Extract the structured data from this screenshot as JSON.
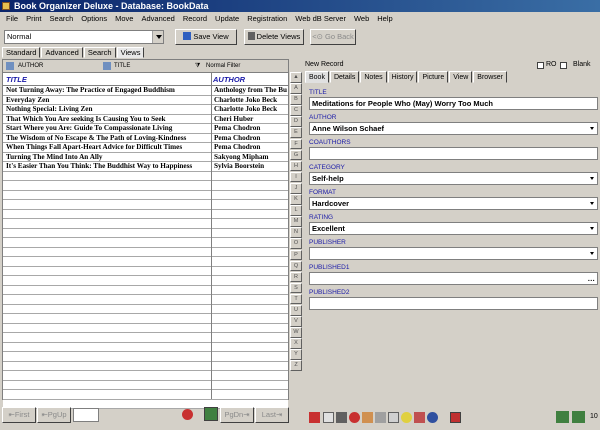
{
  "window": {
    "title": "Book Organizer Deluxe - Database: BookData"
  },
  "menu": [
    "File",
    "Print",
    "Search",
    "Options",
    "Move",
    "Advanced",
    "Record",
    "Update",
    "Registration",
    "Web dB Server",
    "Web",
    "Help"
  ],
  "toolbar": {
    "view_value": "Normal",
    "save_view": "Save View",
    "delete_views": "Delete Views",
    "go_back": "Go Back"
  },
  "left_tabs": [
    "Standard",
    "Advanced",
    "Search",
    "Views"
  ],
  "column_bar": {
    "author": "AUTHOR",
    "title": "TITLE",
    "filter": "Normal Filter"
  },
  "grid": {
    "headers": [
      "TITLE",
      "AUTHOR"
    ],
    "rows": [
      [
        "Not Turning Away: The Practice of Engaged Buddhism",
        "Anthology from The Bu"
      ],
      [
        "Everyday Zen",
        "Charlotte Joko Beck"
      ],
      [
        "Nothing Special: Living Zen",
        "Charlotte Joko Beck"
      ],
      [
        "That Which You Are seeking Is Causing You to Seek",
        "Cheri Huber"
      ],
      [
        "Start Where you Are: Guide To Compassionate Living",
        "Pema Chodron"
      ],
      [
        "The Wisdom of No Escape & The Path of Loving-Kindness",
        "Pema Chodron"
      ],
      [
        "When Things Fall Apart-Heart Advice for Difficult Times",
        "Pema Chodron"
      ],
      [
        "Turning The Mind Into An Ally",
        "Sakyong Mipham"
      ],
      [
        "It's Easier Than You Think: The Buddhist Way to Happiness",
        "Sylvia Boorstein"
      ]
    ]
  },
  "nav": {
    "first": "First",
    "pgup": "PgUp",
    "pgdn": "PgDn",
    "last": "Last"
  },
  "alphabet": [
    "A",
    "B",
    "C",
    "D",
    "E",
    "F",
    "G",
    "H",
    "I",
    "J",
    "K",
    "L",
    "M",
    "N",
    "O",
    "P",
    "Q",
    "R",
    "S",
    "T",
    "U",
    "V",
    "W",
    "X",
    "Y",
    "Z"
  ],
  "record": {
    "status": "New Record",
    "ro_label": "RO",
    "blank_label": "Blank"
  },
  "right_tabs": [
    "Book",
    "Details",
    "Notes",
    "History",
    "Picture",
    "View",
    "Browser"
  ],
  "fields": {
    "title_label": "TITLE",
    "title_value": "Meditations for People Who (May) Worry Too Much",
    "author_label": "AUTHOR",
    "author_value": "Anne Wilson Schaef",
    "coauthors_label": "COAUTHORS",
    "coauthors_value": "",
    "category_label": "CATEGORY",
    "category_value": "Self-help",
    "format_label": "FORMAT",
    "format_value": "Hardcover",
    "rating_label": "RATING",
    "rating_value": "Excellent",
    "publisher_label": "PUBLISHER",
    "publisher_value": "",
    "published1_label": "PUBLISHED1",
    "published1_value": "",
    "published2_label": "PUBLISHED2",
    "published2_value": ""
  },
  "status_corner": "10"
}
